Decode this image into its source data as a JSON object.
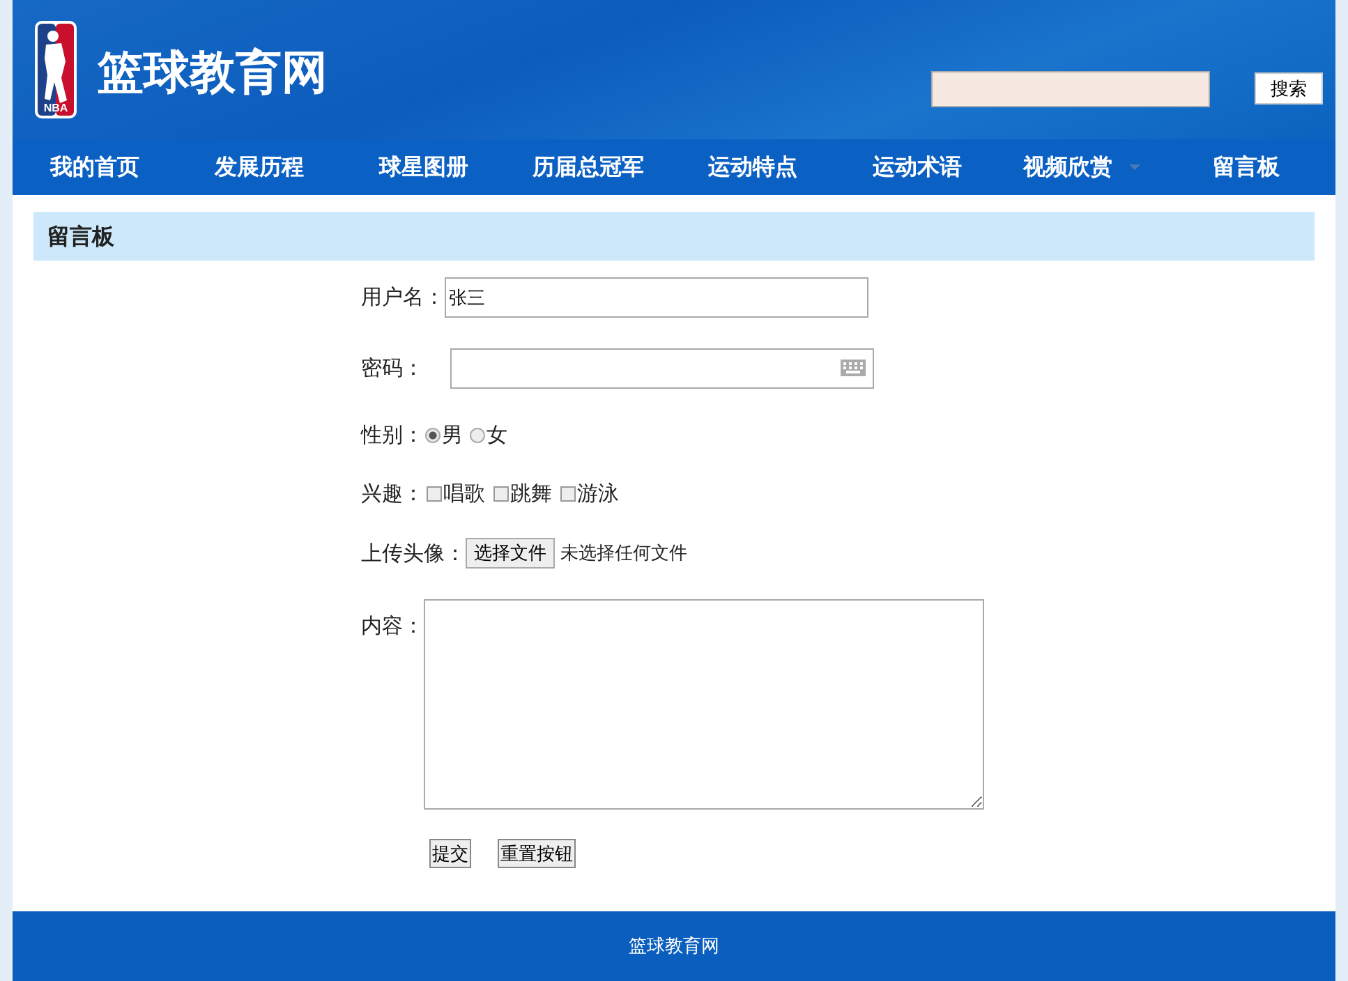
{
  "header": {
    "logo_text": "NBA",
    "site_title": "篮球教育网",
    "search_button": "搜索"
  },
  "nav": [
    {
      "label": "我的首页",
      "has_dropdown": false
    },
    {
      "label": "发展历程",
      "has_dropdown": false
    },
    {
      "label": "球星图册",
      "has_dropdown": false
    },
    {
      "label": "历届总冠军",
      "has_dropdown": false
    },
    {
      "label": "运动特点",
      "has_dropdown": false
    },
    {
      "label": "运动术语",
      "has_dropdown": false
    },
    {
      "label": "视频欣赏",
      "has_dropdown": true
    },
    {
      "label": "留言板",
      "has_dropdown": false
    }
  ],
  "section_title": "留言板",
  "form": {
    "username": {
      "label": "用户名：",
      "value": "张三"
    },
    "password": {
      "label": "密码："
    },
    "gender": {
      "label": "性别：",
      "options": [
        {
          "label": "男",
          "selected": true
        },
        {
          "label": "女",
          "selected": false
        }
      ]
    },
    "hobbies": {
      "label": "兴趣：",
      "options": [
        {
          "label": "唱歌",
          "checked": false
        },
        {
          "label": "跳舞",
          "checked": false
        },
        {
          "label": "游泳",
          "checked": false
        }
      ]
    },
    "avatar": {
      "label": "上传头像：",
      "button": "选择文件",
      "status": "未选择任何文件"
    },
    "content": {
      "label": "内容："
    },
    "buttons": [
      "提交",
      "重置按钮"
    ]
  },
  "footer": "篮球教育网"
}
